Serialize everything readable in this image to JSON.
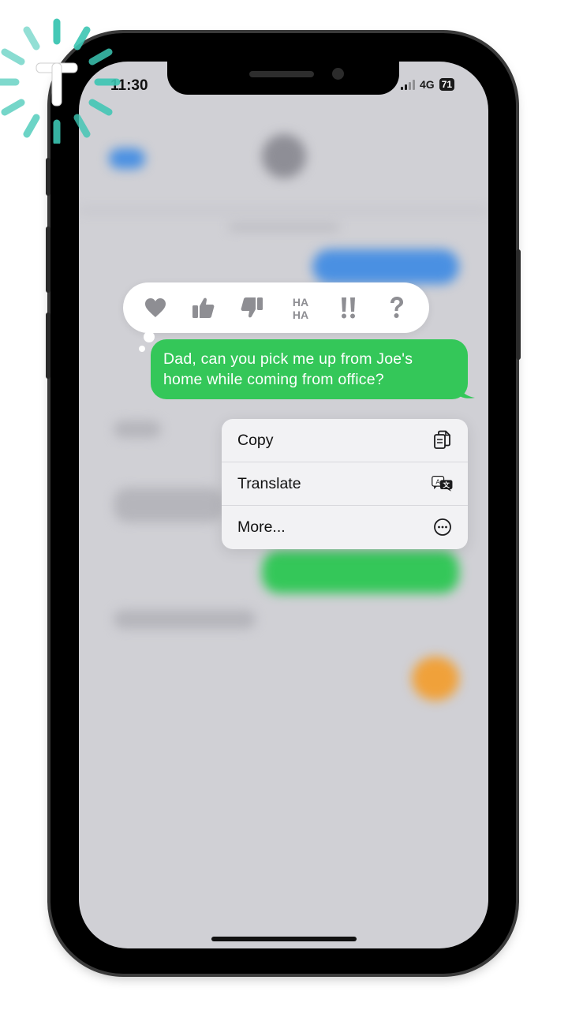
{
  "status_bar": {
    "time": "11:30",
    "network": "4G",
    "battery": "71"
  },
  "reactions": [
    {
      "name": "heart-icon"
    },
    {
      "name": "thumbs-up-icon"
    },
    {
      "name": "thumbs-down-icon"
    },
    {
      "name": "haha-icon",
      "text": "HA HA"
    },
    {
      "name": "exclamation-icon",
      "text": "!!"
    },
    {
      "name": "question-icon",
      "text": "?"
    }
  ],
  "message": {
    "text": "Dad, can you pick me up from Joe's home while coming from office?"
  },
  "context_menu": {
    "items": [
      {
        "label": "Copy",
        "icon": "copy-icon"
      },
      {
        "label": "Translate",
        "icon": "translate-icon"
      },
      {
        "label": "More...",
        "icon": "ellipsis-circle-icon"
      }
    ]
  },
  "colors": {
    "bubble": "#34c759",
    "accent_blue": "#4a90e2",
    "logo": "#3cc6b3",
    "menu_bg": "#f2f2f4",
    "screen_bg": "#d0d0d5"
  }
}
